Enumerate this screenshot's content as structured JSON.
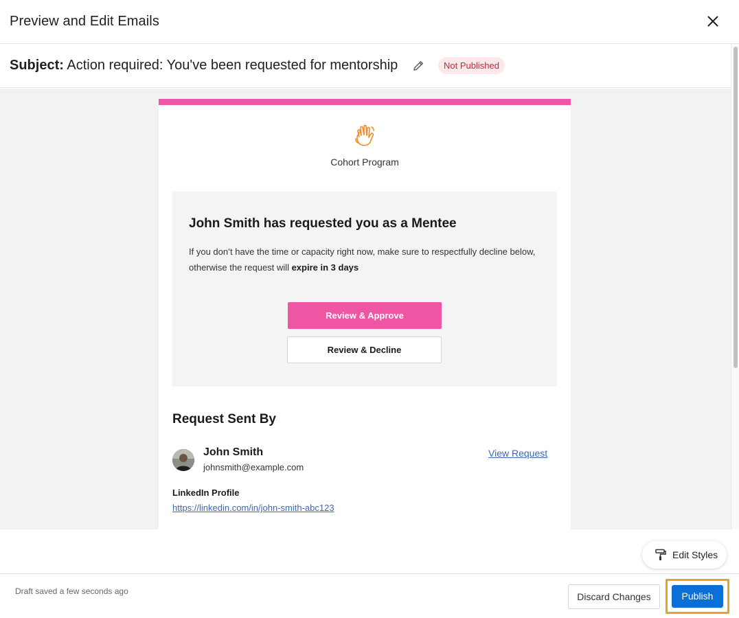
{
  "header": {
    "title": "Preview and Edit Emails",
    "close_icon": "close-icon"
  },
  "subject": {
    "prefix": "Subject:",
    "text": "Action required: You've been requested for mentorship",
    "edit_icon": "pencil-icon",
    "status_badge": "Not Published",
    "status_color": "#c4283c"
  },
  "email": {
    "accent_color": "#f056a8",
    "logo_icon": "waving-hand-icon",
    "program_name": "Cohort Program",
    "card": {
      "heading": "John Smith has requested you as a Mentee",
      "body_start": "If you don’t have the time or capacity right now, make sure to respectfully decline below, otherwise the request will ",
      "body_bold": "expire in 3 days",
      "approve_label": "Review & Approve",
      "decline_label": "Review & Decline"
    },
    "sender_section": {
      "heading": "Request Sent By",
      "name": "John Smith",
      "email": "johnsmith@example.com",
      "view_request_label": "View Request",
      "linkedin_label": "LinkedIn Profile",
      "linkedin_url": "https://linkedin.com/in/john-smith-abc123"
    }
  },
  "edit_styles": {
    "label": "Edit Styles",
    "icon": "paint-roller-icon"
  },
  "footer": {
    "draft_status": "Draft saved a few seconds ago",
    "discard_label": "Discard Changes",
    "publish_label": "Publish",
    "publish_color": "#0b6fd8"
  }
}
